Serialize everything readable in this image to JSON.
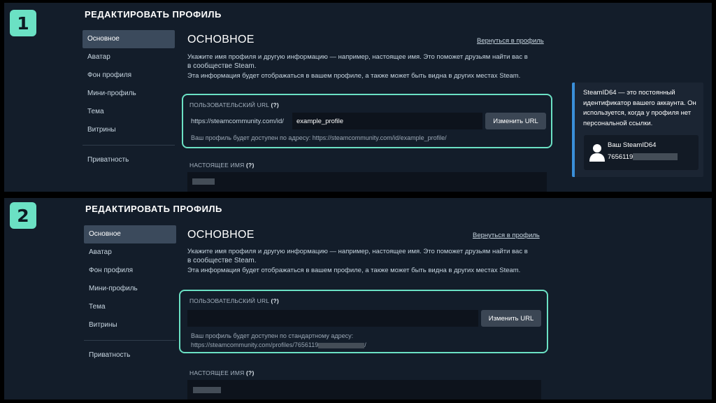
{
  "panel1": {
    "step": "1",
    "page_title": "РЕДАКТИРОВАТЬ ПРОФИЛЬ",
    "sidebar": [
      "Основное",
      "Аватар",
      "Фон профиля",
      "Мини-профиль",
      "Тема",
      "Витрины",
      "Приватность"
    ],
    "section_title": "ОСНОВНОЕ",
    "back_link": "Вернуться в профиль",
    "desc_line1": "Укажите имя профиля и другую информацию — например, настоящее имя. Это поможет друзьям найти вас в",
    "desc_line2": "в сообществе Steam.",
    "desc_line3": "Эта информация будет отображаться в вашем профиле, а также может быть видна в других местах Steam.",
    "url_label": "ПОЛЬЗОВАТЕЛЬСКИЙ URL",
    "help_mark": "(?)",
    "url_prefix": "https://steamcommunity.com/id/",
    "url_value": "example_profile",
    "change_url_button": "Изменить URL",
    "url_hint": "Ваш профиль будет доступен по адресу: https://steamcommunity.com/id/example_profile/",
    "real_name_label": "НАСТОЯЩЕЕ ИМЯ"
  },
  "panel2": {
    "step": "2",
    "page_title": "РЕДАКТИРОВАТЬ ПРОФИЛЬ",
    "sidebar": [
      "Основное",
      "Аватар",
      "Фон профиля",
      "Мини-профиль",
      "Тема",
      "Витрины",
      "Приватность"
    ],
    "section_title": "ОСНОВНОЕ",
    "back_link": "Вернуться в профиль",
    "desc_line1": "Укажите имя профиля и другую информацию — например, настоящее имя. Это поможет друзьям найти вас в",
    "desc_line2": "в сообществе Steam.",
    "desc_line3": "Эта информация будет отображаться в вашем профиле, а также может быть видна в других местах Steam.",
    "url_label": "ПОЛЬЗОВАТЕЛЬСКИЙ URL",
    "help_mark": "(?)",
    "url_value": "",
    "change_url_button": "Изменить URL",
    "url_hint_line1": "Ваш профиль будет доступен по стандартному адресу:",
    "url_hint_prefix": "https://steamcommunity.com/profiles/7656119",
    "url_hint_suffix": "/",
    "real_name_label": "НАСТОЯЩЕЕ ИМЯ"
  },
  "tip": {
    "text": "SteamID64 — это постоянный идентификатор вашего аккаунта. Он используется, когда у профиля нет персональной ссылки.",
    "card_label": "Ваш SteamID64",
    "card_id_prefix": "7656119",
    "avatar_icon": "user-icon"
  },
  "colors": {
    "accent": "#6be1c4",
    "panel_bg": "#131d2a",
    "tip_border": "#3a8fd9"
  }
}
